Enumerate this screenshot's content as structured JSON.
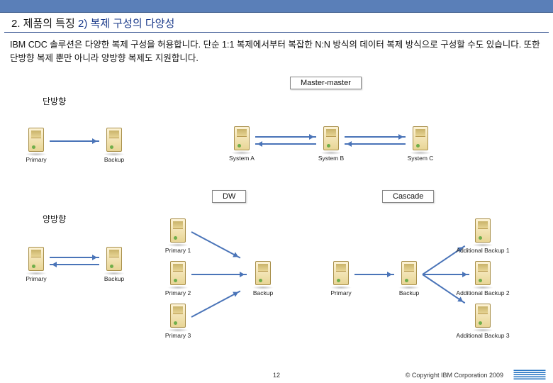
{
  "heading": {
    "main": "2. 제품의 특징",
    "sub": "2) 복제 구성의 다양성"
  },
  "body_text": "IBM CDC 솔루션은 다양한 복제 구성을 허용합니다. 단순 1:1 복제에서부터 복잡한 N:N 방식의 데이터 복제 방식으로 구성할 수도 있습니다. 또한 단방향 복제 뿐만 아니라 양방향 복제도 지원합니다.",
  "labels": {
    "oneway": "단방향",
    "twoway": "양방향",
    "master_master": "Master-master",
    "dw": "DW",
    "cascade": "Cascade"
  },
  "captions": {
    "primary": "Primary",
    "backup": "Backup",
    "system_a": "System A",
    "system_b": "System B",
    "system_c": "System C",
    "primary1": "Primary 1",
    "primary2": "Primary 2",
    "primary3": "Primary 3",
    "add_backup1": "Additional Backup 1",
    "add_backup2": "Additional Backup 2",
    "add_backup3": "Additional Backup 3"
  },
  "footer": {
    "page": "12",
    "copyright": "© Copyright IBM Corporation 2009",
    "logo_text": "IBM"
  }
}
